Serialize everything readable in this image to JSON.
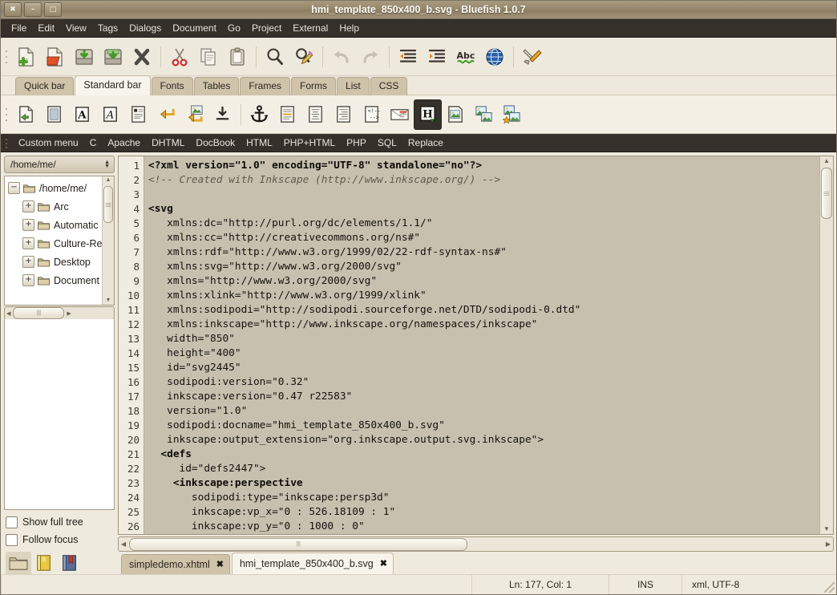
{
  "window": {
    "title": "hmi_template_850x400_b.svg - Bluefish 1.0.7",
    "close_label": "✖",
    "minimize_label": "–",
    "maximize_label": "□"
  },
  "menubar": {
    "items": [
      "File",
      "Edit",
      "View",
      "Tags",
      "Dialogs",
      "Document",
      "Go",
      "Project",
      "External",
      "Help"
    ]
  },
  "main_toolbar": {
    "buttons": [
      {
        "name": "new-file-icon",
        "tooltip": "New"
      },
      {
        "name": "open-file-icon",
        "tooltip": "Open"
      },
      {
        "name": "save-file-icon",
        "tooltip": "Save"
      },
      {
        "name": "save-as-icon",
        "tooltip": "Save as"
      },
      {
        "name": "close-file-icon",
        "tooltip": "Close"
      },
      {
        "name": "cut-icon",
        "tooltip": "Cut"
      },
      {
        "name": "copy-icon",
        "tooltip": "Copy"
      },
      {
        "name": "paste-icon",
        "tooltip": "Paste"
      },
      {
        "name": "find-icon",
        "tooltip": "Find"
      },
      {
        "name": "find-replace-icon",
        "tooltip": "Replace"
      },
      {
        "name": "undo-icon",
        "tooltip": "Undo"
      },
      {
        "name": "redo-icon",
        "tooltip": "Redo"
      },
      {
        "name": "unindent-icon",
        "tooltip": "Unindent"
      },
      {
        "name": "indent-icon",
        "tooltip": "Indent"
      },
      {
        "name": "spellcheck-icon",
        "tooltip": "Spell check"
      },
      {
        "name": "preview-browser-icon",
        "tooltip": "Preview in browser"
      },
      {
        "name": "preferences-icon",
        "tooltip": "Preferences"
      }
    ]
  },
  "bar_tabs": {
    "items": [
      "Quick bar",
      "Standard bar",
      "Fonts",
      "Tables",
      "Frames",
      "Forms",
      "List",
      "CSS"
    ],
    "selected": "Standard bar"
  },
  "standard_toolbar": {
    "buttons": [
      {
        "name": "quickstart-icon"
      },
      {
        "name": "body-icon"
      },
      {
        "name": "bold-icon",
        "glyph": "A"
      },
      {
        "name": "italic-icon",
        "glyph": "A"
      },
      {
        "name": "paragraph-icon"
      },
      {
        "name": "break-icon"
      },
      {
        "name": "break-clear-icon"
      },
      {
        "name": "non-breaking-space-icon"
      },
      {
        "name": "anchor-icon"
      },
      {
        "name": "rule-icon"
      },
      {
        "name": "center-icon"
      },
      {
        "name": "right-justify-icon"
      },
      {
        "name": "comment-icon"
      },
      {
        "name": "email-icon"
      },
      {
        "name": "heading-icon",
        "glyph": "H",
        "active": true
      },
      {
        "name": "image-icon"
      },
      {
        "name": "thumbnail-icon"
      },
      {
        "name": "multi-thumbnail-icon"
      }
    ]
  },
  "custom_menu_bar": {
    "items": [
      "Custom menu",
      "C",
      "Apache",
      "DHTML",
      "DocBook",
      "HTML",
      "PHP+HTML",
      "PHP",
      "SQL",
      "Replace"
    ]
  },
  "sidebar": {
    "path_value": "/home/me/",
    "tree": [
      {
        "label": "/home/me/",
        "expander": "−",
        "indent": 0
      },
      {
        "label": "Arc",
        "expander": "+",
        "indent": 1
      },
      {
        "label": "Automatic",
        "expander": "+",
        "indent": 1
      },
      {
        "label": "Culture-Re",
        "expander": "+",
        "indent": 1
      },
      {
        "label": "Desktop",
        "expander": "+",
        "indent": 1
      },
      {
        "label": "Document",
        "expander": "+",
        "indent": 1
      }
    ],
    "checkboxes": [
      {
        "label": "Show full tree",
        "checked": false
      },
      {
        "label": "Follow focus",
        "checked": false
      }
    ],
    "bottom_icons": [
      {
        "name": "filebrowser-icon",
        "selected": true
      },
      {
        "name": "bookmarks-icon",
        "selected": false
      },
      {
        "name": "reference-icon",
        "selected": false
      }
    ]
  },
  "editor": {
    "lines": [
      {
        "num": "1",
        "text": "<?xml version=\"1.0\" encoding=\"UTF-8\" standalone=\"no\"?>",
        "style": "bold"
      },
      {
        "num": "2",
        "text": "<!-- Created with Inkscape (http://www.inkscape.org/) -->",
        "style": "comment"
      },
      {
        "num": "3",
        "text": "",
        "style": "plain"
      },
      {
        "num": "4",
        "text": "<svg",
        "style": "bold"
      },
      {
        "num": "5",
        "text": "   xmlns:dc=\"http://purl.org/dc/elements/1.1/\"",
        "style": "plain"
      },
      {
        "num": "6",
        "text": "   xmlns:cc=\"http://creativecommons.org/ns#\"",
        "style": "plain"
      },
      {
        "num": "7",
        "text": "   xmlns:rdf=\"http://www.w3.org/1999/02/22-rdf-syntax-ns#\"",
        "style": "plain"
      },
      {
        "num": "8",
        "text": "   xmlns:svg=\"http://www.w3.org/2000/svg\"",
        "style": "plain"
      },
      {
        "num": "9",
        "text": "   xmlns=\"http://www.w3.org/2000/svg\"",
        "style": "plain"
      },
      {
        "num": "10",
        "text": "   xmlns:xlink=\"http://www.w3.org/1999/xlink\"",
        "style": "plain"
      },
      {
        "num": "11",
        "text": "   xmlns:sodipodi=\"http://sodipodi.sourceforge.net/DTD/sodipodi-0.dtd\"",
        "style": "plain"
      },
      {
        "num": "12",
        "text": "   xmlns:inkscape=\"http://www.inkscape.org/namespaces/inkscape\"",
        "style": "plain"
      },
      {
        "num": "13",
        "text": "   width=\"850\"",
        "style": "plain"
      },
      {
        "num": "14",
        "text": "   height=\"400\"",
        "style": "plain"
      },
      {
        "num": "15",
        "text": "   id=\"svg2445\"",
        "style": "plain"
      },
      {
        "num": "16",
        "text": "   sodipodi:version=\"0.32\"",
        "style": "plain"
      },
      {
        "num": "17",
        "text": "   inkscape:version=\"0.47 r22583\"",
        "style": "plain"
      },
      {
        "num": "18",
        "text": "   version=\"1.0\"",
        "style": "plain"
      },
      {
        "num": "19",
        "text": "   sodipodi:docname=\"hmi_template_850x400_b.svg\"",
        "style": "plain"
      },
      {
        "num": "20",
        "text": "   inkscape:output_extension=\"org.inkscape.output.svg.inkscape\">",
        "style": "plain"
      },
      {
        "num": "21",
        "text": "  <defs",
        "style": "bold"
      },
      {
        "num": "22",
        "text": "     id=\"defs2447\">",
        "style": "plain"
      },
      {
        "num": "23",
        "text": "    <inkscape:perspective",
        "style": "bold"
      },
      {
        "num": "24",
        "text": "       sodipodi:type=\"inkscape:persp3d\"",
        "style": "plain"
      },
      {
        "num": "25",
        "text": "       inkscape:vp_x=\"0 : 526.18109 : 1\"",
        "style": "plain"
      },
      {
        "num": "26",
        "text": "       inkscape:vp_y=\"0 : 1000 : 0\"",
        "style": "plain"
      }
    ]
  },
  "document_tabs": [
    {
      "label": "simpledemo.xhtml",
      "close": "✖",
      "selected": false
    },
    {
      "label": "hmi_template_850x400_b.svg",
      "close": "✖",
      "selected": true
    }
  ],
  "statusbar": {
    "position": "Ln: 177, Col: 1",
    "insert_mode": "INS",
    "encoding": "xml, UTF-8"
  }
}
